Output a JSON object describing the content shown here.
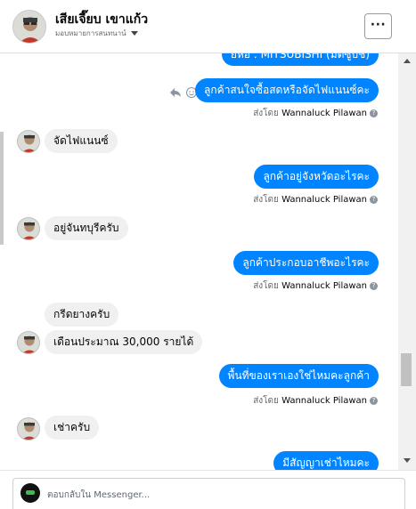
{
  "header": {
    "name": "เสียเจี๊ยบ เขาแก้ว",
    "subtitle": "มอบหมายการสนทนาน์",
    "more_label": "···"
  },
  "thread": {
    "top_partial_text": "ยี่ห้อ : MITSUBISHI (มิตซูบิชิ)",
    "messages": [
      {
        "text": "ลูกค้าสนใจซื้อสดหรือจัดไฟแนนซ์คะ"
      },
      {
        "text": "จัดไฟแนนซ์"
      },
      {
        "text": "ลูกค้าอยู่จังหวัดอะไรคะ"
      },
      {
        "text": "อยู่จันทบุรีครับ"
      },
      {
        "text": "ลูกค้าประกอบอาชีพอะไรคะ"
      },
      {
        "text": "กรีดยางครับ"
      },
      {
        "text": "เดือนประมาณ 30,000 รายได้"
      },
      {
        "text": "พื้นที่ของเราเองใช่ไหมคะลูกค้า"
      },
      {
        "text": "เช่าครับ"
      },
      {
        "text": "มีสัญญาเช่าไหมคะ"
      }
    ],
    "sent_by_label": "ส่งโดย",
    "sent_by_name": "Wannaluck Pilawan",
    "help_glyph": "?"
  },
  "composer": {
    "placeholder": "ตอบกลับใน Messenger..."
  }
}
